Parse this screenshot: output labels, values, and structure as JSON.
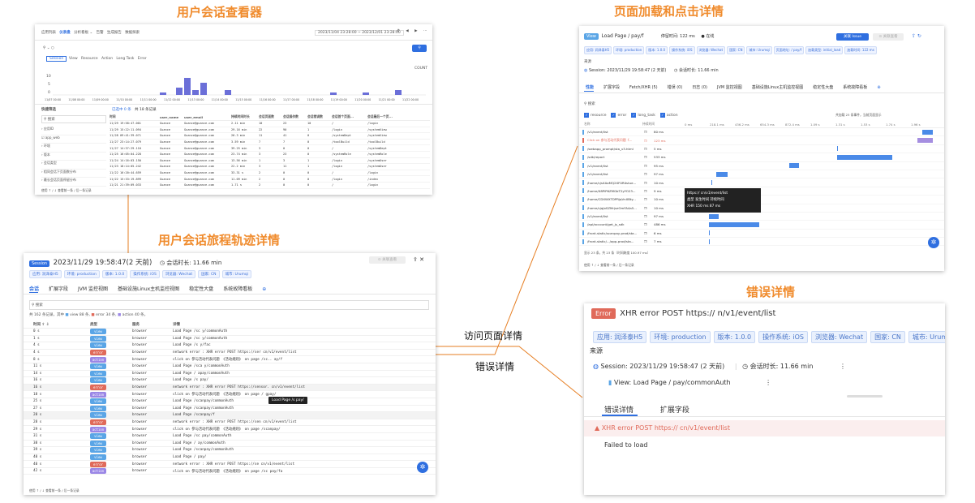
{
  "titles": {
    "viewer": "用户会话查看器",
    "page_detail": "页面加载和点击详情",
    "journey": "用户会话旅程轨迹详情",
    "error_detail": "错误详情"
  },
  "labels": {
    "visit_page_detail": "访问页面详情",
    "error_detail": "错误详情"
  },
  "viewer": {
    "top_tabs": [
      "应用列表",
      "仪表盘",
      "分析看板 ⌄",
      "告警",
      "生成报告",
      "数据探索"
    ],
    "time_range": "2023/11/04 23:28:00 ~ 2023/12/01 23:28:00",
    "filter_tabs": [
      "Session",
      "View",
      "Resource",
      "Action",
      "Long Task",
      "Error"
    ],
    "y_ticks": [
      "10",
      "5",
      "0"
    ],
    "count_label": "COUNT",
    "x_ticks": [
      "11/07 00:00",
      "11/08 00:00",
      "11/09 00:00",
      "11/10 00:00",
      "11/11 00:00",
      "11/12 00:00",
      "11/13 00:00",
      "11/14 00:00",
      "11/15 00:00",
      "11/16 00:00",
      "11/17 00:00",
      "11/18 00:00",
      "11/19 00:00",
      "11/20 00:00",
      "11/21 00:00",
      "11/22 00:00"
    ],
    "bar_values": [
      0,
      0,
      0,
      0,
      0,
      0,
      0,
      0,
      0,
      0,
      0,
      0,
      0,
      1,
      0,
      3,
      7,
      2,
      5,
      0,
      0,
      2,
      0,
      0,
      0,
      0,
      0,
      0,
      0,
      0,
      0,
      0,
      0,
      0,
      1,
      0,
      0,
      0,
      1,
      0,
      0,
      0,
      2,
      0,
      0,
      0
    ],
    "sidebar_title": "快捷筛选",
    "sidebar_items": [
      "应用ID",
      "app_web",
      "环境",
      "版本",
      "会话类型",
      "相同会话下页面数分布",
      "最长会话页面停留分布"
    ],
    "table_toolbar": [
      "已选中 0 条",
      "共 18 条记录"
    ],
    "columns": [
      "时间",
      "user_name",
      "user_email",
      "持续时间时长",
      "会话页面数",
      "会话操作数",
      "会话错误数",
      "会话首个页面...",
      "会话最后一个页..."
    ],
    "rows": [
      {
        "time": "11/29 19:58:47.001",
        "user": "Guance",
        "email": "Guance@guance.com",
        "dur": "2.11 min",
        "pages": "10",
        "actions": "23",
        "errors": "10",
        "first": "/",
        "last": "/login"
      },
      {
        "time": "11/29 15:22:11.094",
        "user": "Guance",
        "email": "Guance@guance.com",
        "dur": "29.16 min",
        "pages": "22",
        "actions": "90",
        "errors": "1",
        "first": "/login",
        "last": "/systemView"
      },
      {
        "time": "11/28 09:41:39.071",
        "user": "Guance",
        "email": "Guance@guance.com",
        "dur": "26.3 min",
        "pages": "11",
        "actions": "41",
        "errors": "0",
        "first": "/systemDept",
        "last": "/systemView"
      },
      {
        "time": "11/27 23:14:27.079",
        "user": "Guance",
        "email": "Guance@guance.com",
        "dur": "3.59 min",
        "pages": "7",
        "actions": "7",
        "errors": "0",
        "first": "/toolBuild",
        "last": "/toolBuild"
      },
      {
        "time": "11/27 14:37:29.110",
        "user": "Guance",
        "email": "Guance@guance.com",
        "dur": "39.25 min",
        "pages": "3",
        "actions": "0",
        "errors": "0",
        "first": "/",
        "last": "/systemDept"
      },
      {
        "time": "11/25 16:05:04.228",
        "user": "Guance",
        "email": "Guance@guance.com",
        "dur": "23.74 min",
        "pages": "3",
        "actions": "23",
        "errors": "0",
        "first": "/systemRole",
        "last": "/systemRole"
      },
      {
        "time": "11/24 14:16:03.150",
        "user": "Guance",
        "email": "Guance@guance.com",
        "dur": "13.56 min",
        "pages": "1",
        "actions": "3",
        "errors": "1",
        "first": "/login",
        "last": "/systemUser"
      },
      {
        "time": "11/23 18:14:05.242",
        "user": "Guance",
        "email": "Guance@guance.com",
        "dur": "22.2 min",
        "pages": "3",
        "actions": "11",
        "errors": "1",
        "first": "/login",
        "last": "/systemUser"
      },
      {
        "time": "11/22 16:20:44.659",
        "user": "Guance",
        "email": "Guance@guance.com",
        "dur": "33.31 s",
        "pages": "2",
        "actions": "0",
        "errors": "0",
        "first": "/",
        "last": "/login"
      },
      {
        "time": "11/22 15:33:19.899",
        "user": "Guance",
        "email": "Guance@guance.com",
        "dur": "11.09 min",
        "pages": "2",
        "actions": "0",
        "errors": "0",
        "first": "/login",
        "last": "/index"
      },
      {
        "time": "11/21 21:39:09.033",
        "user": "Guance",
        "email": "Guance@guance.com",
        "dur": "1.71 s",
        "pages": "2",
        "actions": "0",
        "errors": "0",
        "first": "/",
        "last": "/login"
      }
    ],
    "footer": "使用 ↑ / ↓ 查看前一条 / 后一条记录"
  },
  "journey": {
    "badge": "Session",
    "title": "2023/11/29 19:58:47(2 天前)",
    "duration": "会话时长: 11.66 min",
    "tags": [
      "应用: 润泽泰H5",
      "环境: production",
      "版本: 1.0.0",
      "操作系统: iOS",
      "浏览器: Wechat",
      "国家: CN",
      "城市: Urumqi"
    ],
    "tabs": [
      "会话",
      "扩展字段",
      "JVM 监控视图",
      "基础设施Linux主机监控视图",
      "稳定性大盘",
      "系统故障看板"
    ],
    "search_placeholder": "搜索",
    "summary": "共 162 条记录，其中",
    "legend": [
      "view 88 条,",
      "error 34 条,",
      "action 40 条。"
    ],
    "columns": [
      "时间 ⇧ ⇩",
      "类型",
      "服务",
      "详情"
    ],
    "rows": [
      {
        "t": "0 s",
        "type": "view",
        "svc": "browser",
        "detail": "Load Page /sc    y/commonAuth"
      },
      {
        "t": "1 s",
        "type": "view",
        "svc": "browser",
        "detail": "Load Page /sc    y/commonAuth"
      },
      {
        "t": "4 s",
        "type": "view",
        "svc": "browser",
        "detail": "Load Page /s     y/fac"
      },
      {
        "t": "4 s",
        "type": "error",
        "svc": "browser",
        "detail": "network error : XHR error POST https://ser        cn/v1/event/list"
      },
      {
        "t": "8 s",
        "type": "action",
        "svc": "browser",
        "detail": "click on 参与活动代表问题 《活动规则》 on page /sc..  ay/f"
      },
      {
        "t": "11 s",
        "type": "view",
        "svc": "browser",
        "detail": "Load Page /sca   y/commonAuth"
      },
      {
        "t": "14 s",
        "type": "view",
        "svc": "browser",
        "detail": "Load Page /    apay/commonAuth"
      },
      {
        "t": "16 s",
        "type": "view",
        "svc": "browser",
        "detail": "Load Page /s   pay/"
      },
      {
        "t": "16 s",
        "type": "error",
        "svc": "browser",
        "detail": "network error : XHR error POST https://sensor.    cn/v1/event/list"
      },
      {
        "t": "18 s",
        "type": "action",
        "svc": "browser",
        "detail": "click on 参与活动代表问题 《活动规则》 on page /    gpay/"
      },
      {
        "t": "25 s",
        "type": "view",
        "svc": "browser",
        "detail": "Load Page /scanpay/commonAuth"
      },
      {
        "t": "27 s",
        "type": "view",
        "svc": "browser",
        "detail": "Load Page /scanpay/commonAuth"
      },
      {
        "t": "28 s",
        "type": "view",
        "svc": "browser",
        "detail": "Load Page /scanpay/f"
      },
      {
        "t": "28 s",
        "type": "error",
        "svc": "browser",
        "detail": "network error : XHR error POST https://sen        cn/v1/event/list"
      },
      {
        "t": "29 s",
        "type": "action",
        "svc": "browser",
        "detail": "click on 参与活动代表问题 《活动规则》 on page /scanpay/"
      },
      {
        "t": "31 s",
        "type": "view",
        "svc": "browser",
        "detail": "Load Page /sc   pay/commonAuth"
      },
      {
        "t": "38 s",
        "type": "view",
        "svc": "browser",
        "detail": "Load Page /    ay/commonAuth"
      },
      {
        "t": "39 s",
        "type": "view",
        "svc": "browser",
        "detail": "Load Page /scanpay/commonAuth"
      },
      {
        "t": "40 s",
        "type": "view",
        "svc": "browser",
        "detail": "Load Page /     pay/"
      },
      {
        "t": "40 s",
        "type": "error",
        "svc": "browser",
        "detail": "network error : XHR error POST https://se        cn/v1/event/list"
      },
      {
        "t": "42 s",
        "type": "action",
        "svc": "browser",
        "detail": "click on 参与活动代表问题 《活动规则》 on page /sc   pay/fa"
      }
    ],
    "tooltip": "Load Page /s   pay/",
    "footer": "使用 ↑ / ↓ 查看前一条 / 后一条记录"
  },
  "page_detail": {
    "badge": "View",
    "title": "Load Page /     pay/f",
    "stay": "停留时间: 122 ms",
    "active": "● 在线",
    "btn": "关联 Issue",
    "tags": [
      "应用: 润泽泰H5",
      "环境: production",
      "版本: 1.0.0",
      "操作系统: iOS",
      "浏览器: Wechat",
      "国家: CN",
      "城市: Urumqi",
      "页面地址: /     pay/f",
      "加载类型: initial_load",
      "加载时间: 122 ms"
    ],
    "source": "来源",
    "session": "Session: 2023/11/29 19:58:47 (2 天前)",
    "session_dur": "会话时长: 11.66 min",
    "tabs": [
      "性能",
      "扩展字段",
      "Fetch/XHR (5)",
      "错误 (0)",
      "日志 (0)",
      "JVM 监控视图",
      "基础设施Linux主机监控视图",
      "稳定性大盘",
      "系统故障看板"
    ],
    "filters": [
      "resource",
      "error",
      "long_task",
      "action"
    ],
    "filter_note": "共加载 23 条事件，当前页面显示",
    "columns": [
      "名称",
      "持续时间",
      "0 ms",
      "218.1 ms",
      "436.2 ms",
      "654.3 ms",
      "872.4 ms",
      "1.09 s",
      "1.31 s",
      "1.53 s",
      "1.74 s",
      "1.96 s"
    ],
    "rows": [
      {
        "name": "/v1/event/list",
        "dur": "80 ms",
        "start": 0.94,
        "width": 0.04,
        "color": "#4a8ae8"
      },
      {
        "name": "Click on 参与活动代表问题《...",
        "dur": "123 ms",
        "start": 0.92,
        "width": 0.06,
        "color": "#a58ee0",
        "error": true
      },
      {
        "name": "/webapp_prompt/sta_v3.html",
        "dur": "5 ms",
        "start": 0.6,
        "width": 0.004,
        "color": "#4a8ae8"
      },
      {
        "name": "/sdk/report",
        "dur": "533 ms",
        "start": 0.6,
        "width": 0.22,
        "color": "#4a8ae8"
      },
      {
        "name": "/v1/event/list",
        "dur": "95 ms",
        "start": 0.41,
        "width": 0.04,
        "color": "#4a8ae8"
      },
      {
        "name": "/v1/event/list",
        "dur": "97 ms",
        "start": 0.12,
        "width": 0.045,
        "color": "#4a8ae8"
      },
      {
        "name": "/home/cjsXAaMQ2XF0R0stue...",
        "dur": "10 ms",
        "start": 0.1,
        "width": 0.004,
        "color": "#4a8ae8"
      },
      {
        "name": "/home/X8PiP6ZMGbT2yYO23...",
        "dur": "9 ms",
        "start": 0.1,
        "width": 0.004,
        "color": "#4a8ae8"
      },
      {
        "name": "/home/CDXWXTDPRjqVnXBty...",
        "dur": "10 ms",
        "start": 0.1,
        "width": 0.004,
        "color": "#4a8ae8"
      },
      {
        "name": "/home/cjqJoSZMrjseOmFA4a5...",
        "dur": "10 ms",
        "start": 0.1,
        "width": 0.004,
        "color": "#4a8ae8"
      },
      {
        "name": "/v1/event/list",
        "dur": "97 ms",
        "start": 0.09,
        "width": 0.04,
        "color": "#4a8ae8"
      },
      {
        "name": "/api/account/get_js_sdk",
        "dur": "486 ms",
        "start": 0.09,
        "width": 0.2,
        "color": "#4a8ae8"
      },
      {
        "name": "/front-static/scanpay-prod/sta...",
        "dur": "6 ms",
        "start": 0.09,
        "width": 0.004,
        "color": "#4a8ae8"
      },
      {
        "name": "/front-static/.../app-prod/sta...",
        "dur": "7 ms",
        "start": 0.09,
        "width": 0.004,
        "color": "#4a8ae8"
      }
    ],
    "tooltip": {
      "url": "https://                  cn/v1/event/list",
      "h": "类型    发生时间    持续时间",
      "v": "XHR    150 ms    87 ms"
    },
    "count": "显示 23 条，共 23 条（时间跨度 100.97 ms）",
    "footer": "使用 ↑ / ↓ 查看前一条 / 后一条记录"
  },
  "error_detail": {
    "badge": "Error",
    "title": "XHR error POST https://              n/v1/event/list",
    "tags": [
      "应用: 润泽泰H5",
      "环境: production",
      "版本: 1.0.0",
      "操作系统: iOS",
      "浏览器: Wechat",
      "国家: CN",
      "城市: Urumqi"
    ],
    "source": "来源",
    "session": "Session: 2023/11/29 19:58:47 (2 天前)",
    "session_dur": "会话时长: 11.66 min",
    "view": "View: Load Page /      pay/commonAuth",
    "tabs": [
      "错误详情",
      "扩展字段"
    ],
    "error_line": "XHR error POST https://            cn/v1/event/list",
    "message": "Failed to load"
  },
  "colors": {
    "title": "#f08c2e",
    "primary": "#2f6fe0",
    "view": "#5aa5e6",
    "error": "#e06a5a",
    "action": "#9a86e6",
    "line": "#e67e22"
  }
}
